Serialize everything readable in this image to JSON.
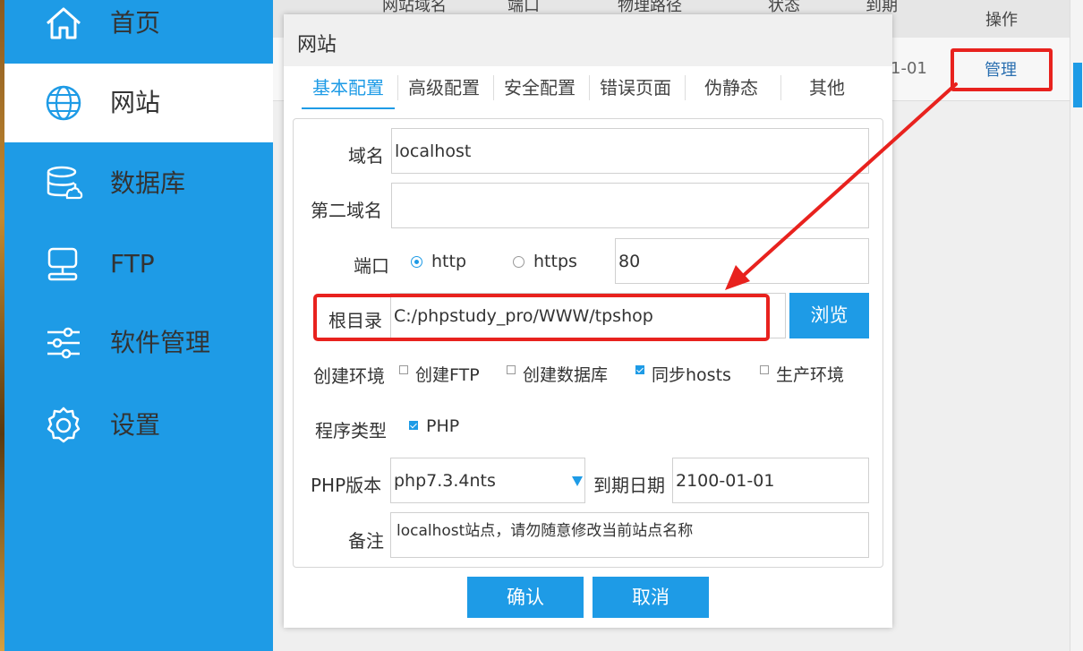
{
  "sidebar": {
    "items": [
      {
        "label": "首页",
        "icon": "home-icon"
      },
      {
        "label": "网站",
        "icon": "globe-icon",
        "active": true
      },
      {
        "label": "数据库",
        "icon": "database-icon"
      },
      {
        "label": "FTP",
        "icon": "server-icon"
      },
      {
        "label": "软件管理",
        "icon": "sliders-icon"
      },
      {
        "label": "设置",
        "icon": "gear-icon"
      }
    ]
  },
  "background_table": {
    "headers": [
      "网站域名",
      "端口",
      "物理路径",
      "状态",
      "到期",
      "操作"
    ],
    "row": {
      "expiry_fragment": "1-01",
      "action": "管理"
    }
  },
  "modal": {
    "title": "网站",
    "tabs": [
      "基本配置",
      "高级配置",
      "安全配置",
      "错误页面",
      "伪静态",
      "其他"
    ],
    "form": {
      "domain_label": "域名",
      "domain_value": "localhost",
      "second_domain_label": "第二域名",
      "second_domain_value": "",
      "port_label": "端口",
      "protocol_http": "http",
      "protocol_https": "https",
      "port_value": "80",
      "root_label": "根目录",
      "root_value": "C:/phpstudy_pro/WWW/tpshop",
      "browse_label": "浏览",
      "env_label": "创建环境",
      "env_options": [
        {
          "label": "创建FTP",
          "checked": false
        },
        {
          "label": "创建数据库",
          "checked": false
        },
        {
          "label": "同步hosts",
          "checked": true
        },
        {
          "label": "生产环境",
          "checked": false
        }
      ],
      "program_label": "程序类型",
      "program_option": "PHP",
      "php_version_label": "PHP版本",
      "php_version_value": "php7.3.4nts",
      "expiry_label": "到期日期",
      "expiry_value": "2100-01-01",
      "note_label": "备注",
      "note_value": "localhost站点，请勿随意修改当前站点名称"
    },
    "confirm_label": "确认",
    "cancel_label": "取消"
  },
  "colors": {
    "accent": "#1e9be6",
    "annotation": "#e8221e"
  }
}
